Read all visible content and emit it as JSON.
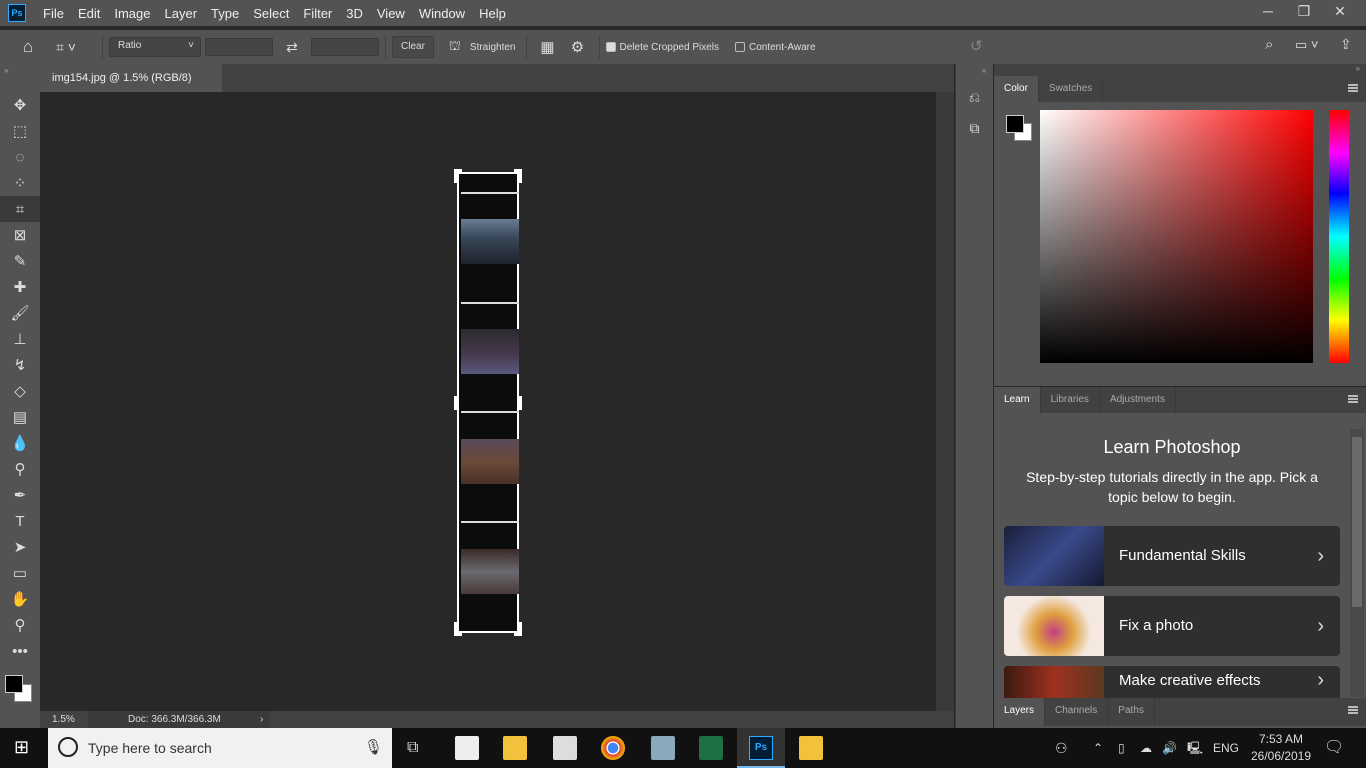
{
  "app": {
    "logo": "Ps",
    "menu": [
      "File",
      "Edit",
      "Image",
      "Layer",
      "Type",
      "Select",
      "Filter",
      "3D",
      "View",
      "Window",
      "Help"
    ]
  },
  "window_controls": {
    "minimize": "─",
    "restore": "❐",
    "close": "✕"
  },
  "options": {
    "ratio": "Ratio",
    "width_value": "",
    "height_value": "",
    "clear": "Clear",
    "straighten": "Straighten",
    "delete_cropped": "Delete Cropped Pixels",
    "delete_cropped_checked": true,
    "content_aware": "Content-Aware",
    "content_aware_checked": false
  },
  "document": {
    "tab_title": "img154.jpg @ 1.5% (RGB/8)",
    "close": "×"
  },
  "status": {
    "zoom": "1.5%",
    "doc": "Doc: 366.3M/366.3M",
    "arrow": "›"
  },
  "color_panel": {
    "tabs": [
      "Color",
      "Swatches"
    ],
    "active": "Color",
    "foreground": "#000000",
    "background": "#ffffff",
    "hue_color": "#ff0000"
  },
  "learn_panel": {
    "tabs": [
      "Learn",
      "Libraries",
      "Adjustments"
    ],
    "active": "Learn",
    "title": "Learn Photoshop",
    "subtitle": "Step-by-step tutorials directly in the app. Pick a topic below to begin.",
    "cards": [
      {
        "label": "Fundamental Skills"
      },
      {
        "label": "Fix a photo"
      },
      {
        "label": "Make creative effects"
      }
    ]
  },
  "layers_panel": {
    "tabs": [
      "Layers",
      "Channels",
      "Paths"
    ],
    "active": "Layers"
  },
  "taskbar": {
    "search_placeholder": "Type here to search",
    "language": "ENG",
    "time": "7:53 AM",
    "date": "26/06/2019"
  }
}
